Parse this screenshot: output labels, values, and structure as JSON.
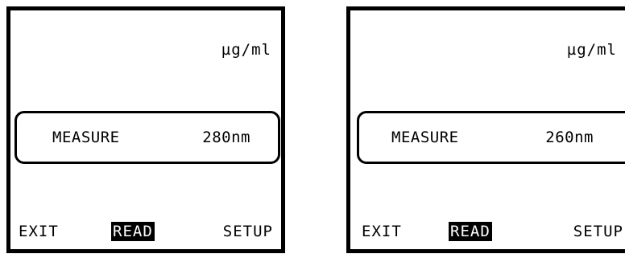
{
  "screens": [
    {
      "unit": "µg/ml",
      "measure_label": "MEASURE",
      "wavelength": "280nm",
      "softkeys": {
        "left": "EXIT",
        "middle": "READ",
        "right": "SETUP"
      }
    },
    {
      "unit": "µg/ml",
      "measure_label": "MEASURE",
      "wavelength": "260nm",
      "softkeys": {
        "left": "EXIT",
        "middle": "READ",
        "right": "SETUP"
      }
    }
  ],
  "colors": {
    "screen_background": "#ffffff",
    "text": "#000000",
    "active_softkey_background": "#000000",
    "active_softkey_text": "#ffffff"
  }
}
